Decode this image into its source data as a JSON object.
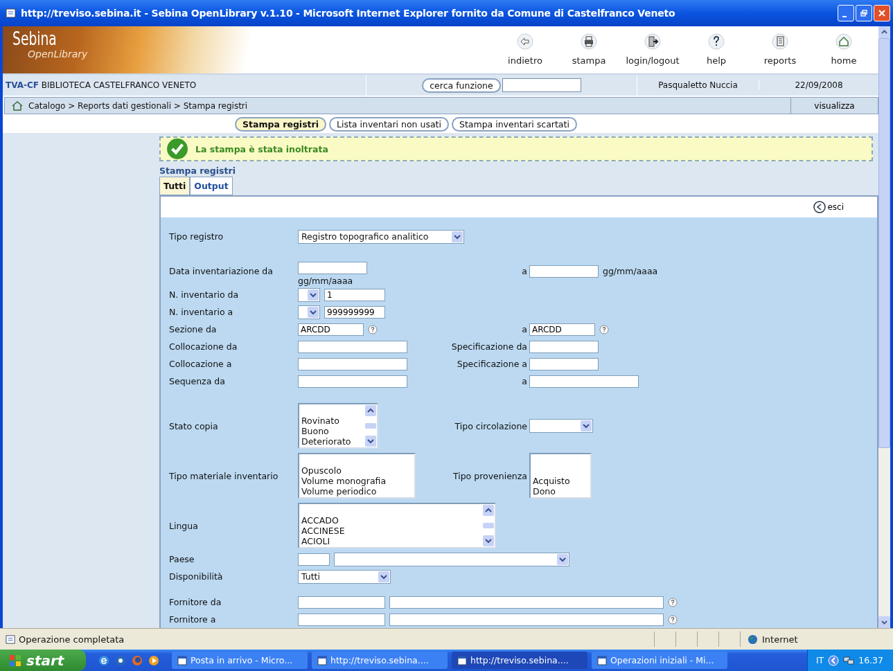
{
  "window": {
    "title": "http://treviso.sebina.it - Sebina OpenLibrary v.1.10 - Microsoft Internet Explorer fornito da Comune di Castelfranco Veneto"
  },
  "header": {
    "logo": {
      "name": "Sebina",
      "subtitle": "OpenLibrary"
    },
    "toolbar": [
      {
        "label": "indietro"
      },
      {
        "label": "stampa"
      },
      {
        "label": "login/logout"
      },
      {
        "label": "help"
      },
      {
        "label": "reports"
      },
      {
        "label": "home"
      }
    ]
  },
  "info_bar": {
    "library_code": "TVA-CF",
    "library_name": "BIBLIOTECA CASTELFRANCO VENETO",
    "search_button": "cerca funzione",
    "user": "Pasqualetto Nuccia",
    "date": "22/09/2008"
  },
  "breadcrumb": {
    "path": "Catalogo > Reports dati gestionali > Stampa registri",
    "action": "visualizza"
  },
  "function_tabs": [
    {
      "label": "Stampa registri",
      "selected": true
    },
    {
      "label": "Lista inventari non usati",
      "selected": false
    },
    {
      "label": "Stampa inventari scartati",
      "selected": false
    }
  ],
  "message": "La stampa è stata inoltrata",
  "section_title": "Stampa registri",
  "tabs": [
    {
      "label": "Tutti",
      "selected": true
    },
    {
      "label": "Output",
      "selected": false
    }
  ],
  "exit_button": "esci",
  "form": [
    {
      "label": "Tipo registro",
      "controls": [
        {
          "kind": "select",
          "value": "Registro topografico analitico"
        }
      ]
    },
    {
      "label": "Data inventariazione da",
      "controls": [
        {
          "kind": "input"
        },
        {
          "kind": "hint",
          "text": "gg/mm/aaaa"
        }
      ],
      "right": {
        "label": "a",
        "controls": [
          {
            "kind": "input"
          },
          {
            "kind": "hint",
            "text": "gg/mm/aaaa"
          }
        ]
      }
    },
    {
      "label": "N. inventario da",
      "controls": [
        {
          "kind": "select"
        },
        {
          "kind": "input",
          "value": "1"
        }
      ]
    },
    {
      "label": "N. inventario a",
      "controls": [
        {
          "kind": "select"
        },
        {
          "kind": "input",
          "value": "999999999"
        }
      ]
    },
    {
      "label": "Sezione da",
      "controls": [
        {
          "kind": "input",
          "value": "ARCDD"
        },
        {
          "kind": "help"
        }
      ],
      "right": {
        "label": "a",
        "controls": [
          {
            "kind": "input",
            "value": "ARCDD"
          },
          {
            "kind": "help"
          }
        ]
      }
    },
    {
      "label": "Collocazione da",
      "controls": [
        {
          "kind": "input"
        }
      ],
      "right": {
        "label": "Specificazione da",
        "controls": [
          {
            "kind": "input"
          }
        ]
      }
    },
    {
      "label": "Collocazione a",
      "controls": [
        {
          "kind": "input"
        }
      ],
      "right": {
        "label": "Specificazione a",
        "controls": [
          {
            "kind": "input"
          }
        ]
      }
    },
    {
      "label": "Sequenza da",
      "controls": [
        {
          "kind": "input"
        }
      ],
      "right": {
        "label": "a",
        "controls": [
          {
            "kind": "input"
          }
        ]
      }
    },
    {
      "label": "Stato copia",
      "controls": [
        {
          "kind": "scroll-listbox",
          "options": [
            "Rovinato",
            "Buono",
            "Deteriorato"
          ]
        }
      ],
      "right": {
        "label": "Tipo circolazione",
        "controls": [
          {
            "kind": "select"
          }
        ]
      }
    },
    {
      "label": "Tipo materiale inventario",
      "controls": [
        {
          "kind": "listbox",
          "options": [
            "Opuscolo",
            "Volume monografia",
            "Volume periodico"
          ]
        }
      ],
      "right": {
        "label": "Tipo provenienza",
        "controls": [
          {
            "kind": "listbox",
            "options": [
              "Acquisto",
              "Dono"
            ]
          }
        ]
      }
    },
    {
      "label": "Lingua",
      "controls": [
        {
          "kind": "scroll-listbox",
          "options": [
            "ACCADO",
            "ACCINESE",
            "ACIOLI"
          ]
        }
      ]
    },
    {
      "label": "Paese",
      "controls": [
        {
          "kind": "input"
        },
        {
          "kind": "select"
        }
      ]
    },
    {
      "label": "Disponibilità",
      "controls": [
        {
          "kind": "select",
          "value": "Tutti"
        }
      ]
    },
    {
      "label": "Fornitore da",
      "controls": [
        {
          "kind": "input"
        },
        {
          "kind": "input"
        },
        {
          "kind": "help"
        }
      ]
    },
    {
      "label": "Fornitore a",
      "controls": [
        {
          "kind": "input"
        },
        {
          "kind": "input"
        },
        {
          "kind": "help"
        }
      ]
    }
  ],
  "status_bar": {
    "text": "Operazione completata",
    "zone": "Internet"
  },
  "taskbar": {
    "start": "start",
    "tasks": [
      {
        "label": "Posta in arrivo - Micro...",
        "selected": false
      },
      {
        "label": "http://treviso.sebina....",
        "selected": false
      },
      {
        "label": "http://treviso.sebina....",
        "selected": true
      },
      {
        "label": "Operazioni iniziali - Mi...",
        "selected": false
      }
    ],
    "language": "IT",
    "clock": "16.37"
  }
}
